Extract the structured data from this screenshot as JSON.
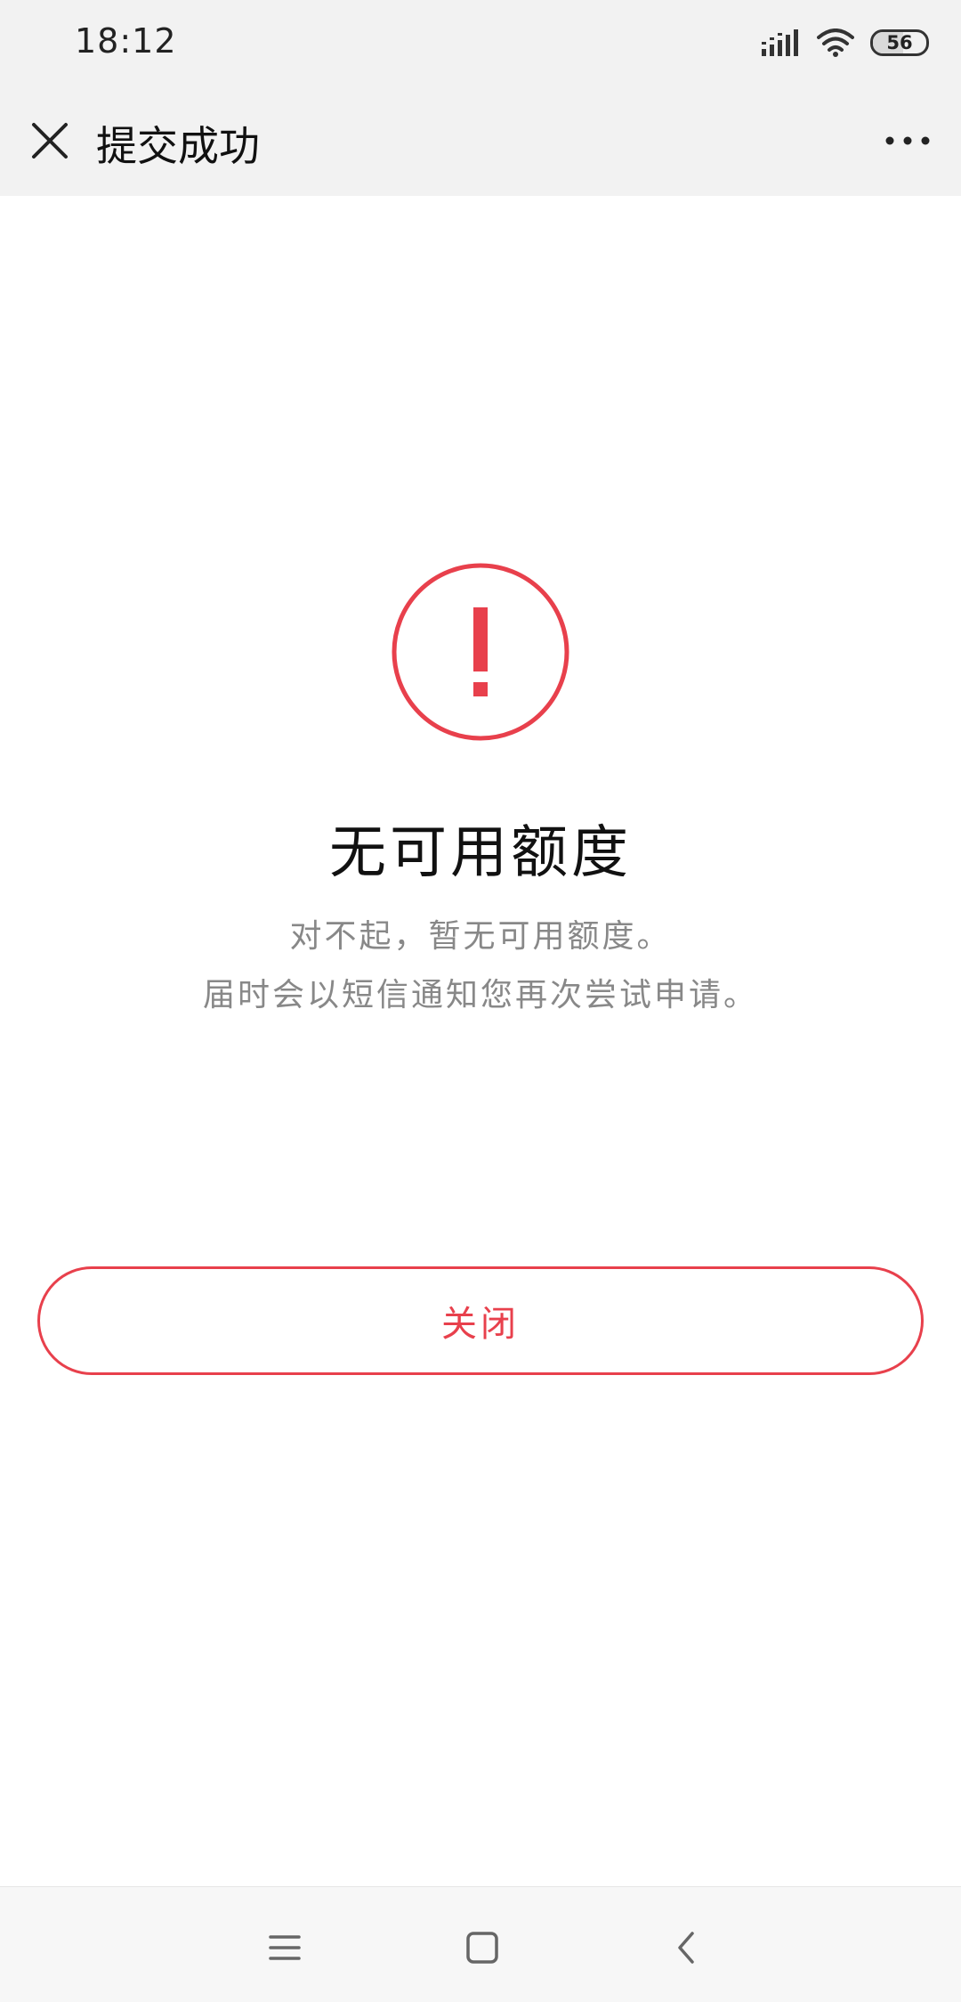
{
  "status_bar": {
    "time": "18:12",
    "battery_level": "56"
  },
  "header": {
    "title": "提交成功"
  },
  "result": {
    "icon": "exclamation-circle-icon",
    "title": "无可用额度",
    "description_line1": "对不起，暂无可用额度。",
    "description_line2": "届时会以短信通知您再次尝试申请。"
  },
  "actions": {
    "close_label": "关闭"
  },
  "colors": {
    "accent": "#e8404c",
    "title_bar_bg": "#f2f2f2",
    "description_text": "#888888"
  },
  "nav_bar": {
    "icons": [
      "menu-icon",
      "home-icon",
      "back-icon"
    ]
  }
}
